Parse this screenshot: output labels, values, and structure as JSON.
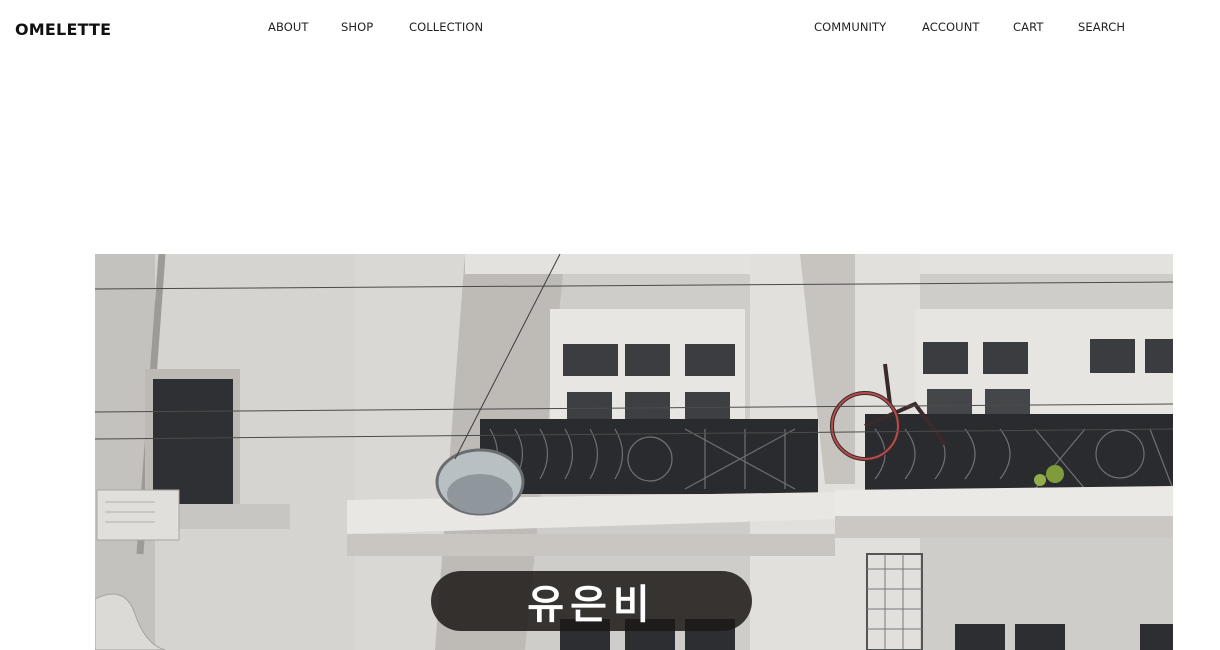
{
  "brand": {
    "name": "OMELETTE"
  },
  "nav": {
    "left": [
      "ABOUT",
      "SHOP",
      "COLLECTION"
    ],
    "right": [
      "COMMUNITY",
      "ACCOUNT",
      "CART",
      "SEARCH"
    ]
  },
  "hero": {
    "caption": "유은비"
  },
  "colors": {
    "background": "#ffffff",
    "text": "#222222",
    "caption_bg": "#1c1816"
  }
}
